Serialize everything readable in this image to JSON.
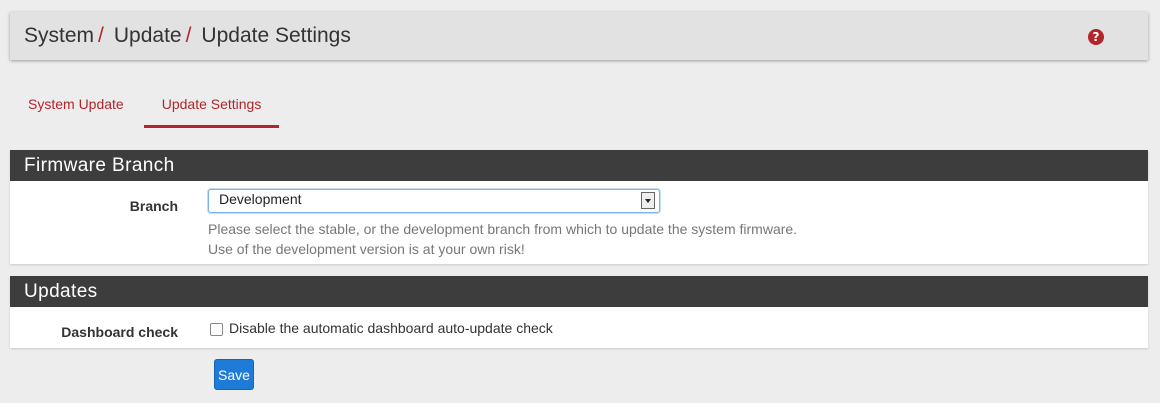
{
  "breadcrumb": {
    "items": [
      "System",
      "Update",
      "Update Settings"
    ],
    "separator": "/"
  },
  "help": {
    "icon": "question-circle-icon",
    "glyph": "?"
  },
  "tabs": [
    {
      "label": "System Update",
      "active": false
    },
    {
      "label": "Update Settings",
      "active": true
    }
  ],
  "firmware_branch": {
    "heading": "Firmware Branch",
    "branch_label": "Branch",
    "branch_selected": "Development",
    "help_line1": "Please select the stable, or the development branch from which to update the system firmware.",
    "help_line2": "Use of the development version is at your own risk!"
  },
  "updates": {
    "heading": "Updates",
    "dashboard_label": "Dashboard check",
    "checkbox_label": "Disable the automatic dashboard auto-update check",
    "checkbox_checked": false
  },
  "actions": {
    "save_label": "Save"
  },
  "colors": {
    "accent": "#b2262b",
    "panel_heading": "#3d3d3d",
    "primary_button": "#1e7bd8",
    "background": "#ededed"
  }
}
